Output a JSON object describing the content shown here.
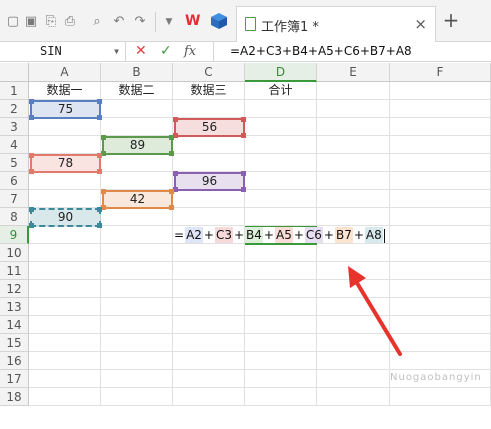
{
  "tab": {
    "title": "工作簿1 *",
    "close_glyph": "×",
    "new_tab_glyph": "+"
  },
  "formula_bar": {
    "name_box": "SIN",
    "cancel_glyph": "✕",
    "confirm_glyph": "✓",
    "fx_label": "fx",
    "formula": "=A2+C3+B4+A5+C6+B7+A8"
  },
  "columns": [
    "A",
    "B",
    "C",
    "D",
    "E",
    "F"
  ],
  "rows": [
    "1",
    "2",
    "3",
    "4",
    "5",
    "6",
    "7",
    "8",
    "9",
    "10",
    "11",
    "12",
    "13",
    "14",
    "15",
    "16",
    "17",
    "18"
  ],
  "headers": {
    "A1": "数据一",
    "B1": "数据二",
    "C1": "数据三",
    "D1": "合计"
  },
  "values": {
    "A2": "75",
    "C3": "56",
    "B4": "89",
    "A5": "78",
    "C6": "96",
    "B7": "42",
    "A8": "90"
  },
  "colors": {
    "A2": "#5a7fc0",
    "C3": "#d05a5a",
    "B4": "#5a9a4a",
    "A5": "#e07a6a",
    "C6": "#8a60b0",
    "B7": "#e08a4a",
    "A8": "#3a8a9a",
    "active": "#3a9a3a"
  },
  "editor_tokens": [
    {
      "text": "=",
      "color": null
    },
    {
      "text": "A2",
      "color": "#dde5f6"
    },
    {
      "text": "+",
      "color": null
    },
    {
      "text": "C3",
      "color": "#f6d9d9"
    },
    {
      "text": "+",
      "color": null
    },
    {
      "text": "B4",
      "color": "#dcefd8"
    },
    {
      "text": "+",
      "color": null
    },
    {
      "text": "A5",
      "color": "#fadcd6"
    },
    {
      "text": "+",
      "color": null
    },
    {
      "text": "C6",
      "color": "#e8def3"
    },
    {
      "text": "+",
      "color": null
    },
    {
      "text": "B7",
      "color": "#fae3cf"
    },
    {
      "text": "+",
      "color": null
    },
    {
      "text": "A8",
      "color": "#d6e9ec"
    }
  ],
  "watermark": "Nuogaobangyin"
}
